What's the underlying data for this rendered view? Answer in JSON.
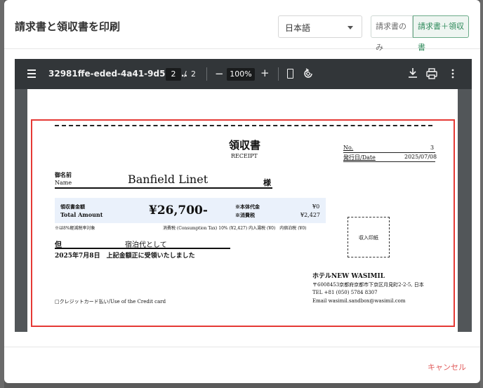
{
  "modal": {
    "title": "請求書と領収書を印刷",
    "language": "日本語",
    "print_options": [
      "請求書のみ",
      "請求書＋領収書"
    ],
    "cancel_label": "キャンセル"
  },
  "pdf_viewer": {
    "file_name": "32981ffe-eded-4a41-9d53-f...",
    "current_page": "2",
    "page_separator": "/",
    "total_pages": "2",
    "zoom": "100%"
  },
  "receipt": {
    "title": "領収書",
    "subtitle": "RECEIPT",
    "no_label": "No.",
    "no_value": "3",
    "date_label": "発行日/Date",
    "date_value": "2025/07/08",
    "name_label_jp": "御名前",
    "name_label_en": "Name",
    "name_value": "Banfield Linet",
    "honorific": "様",
    "amount_label_jp": "領収書金額",
    "amount_label_en": "Total Amount",
    "amount_value": "¥26,700-",
    "base_price_label": "※本体代金",
    "base_price_value": "¥0",
    "tax_label": "※消費税",
    "tax_value": "¥2,427",
    "reduced_rate_note": "※は8%軽減税率対象",
    "tax_detail": "消費税 (Consumption Tax) 10% (¥2,427) 内入湯税 (¥0)　内宿泊税 (¥0)",
    "tadashi": "但",
    "purpose": "宿泊代として",
    "received_statement": "2025年7月8日　上記金額正に受領いたしました",
    "stamp_label": "収入印紙",
    "hotel_name": "ホテルNEW WASIMIL",
    "hotel_address": "〒6008453京都府京都市下京区月見町2-2-5, 日本",
    "hotel_tel": "TEL +81 (050) 5784 8307",
    "hotel_email": "Email wasimil.sandbox@wasimil.com",
    "credit_card_option": "□クレジットカード払い/Use of the Credit card"
  },
  "colors": {
    "frame_red": "#e53935",
    "active_green": "#2f8a5b",
    "cancel_red": "#e05a5a",
    "amount_box": "#eaf1fb"
  }
}
